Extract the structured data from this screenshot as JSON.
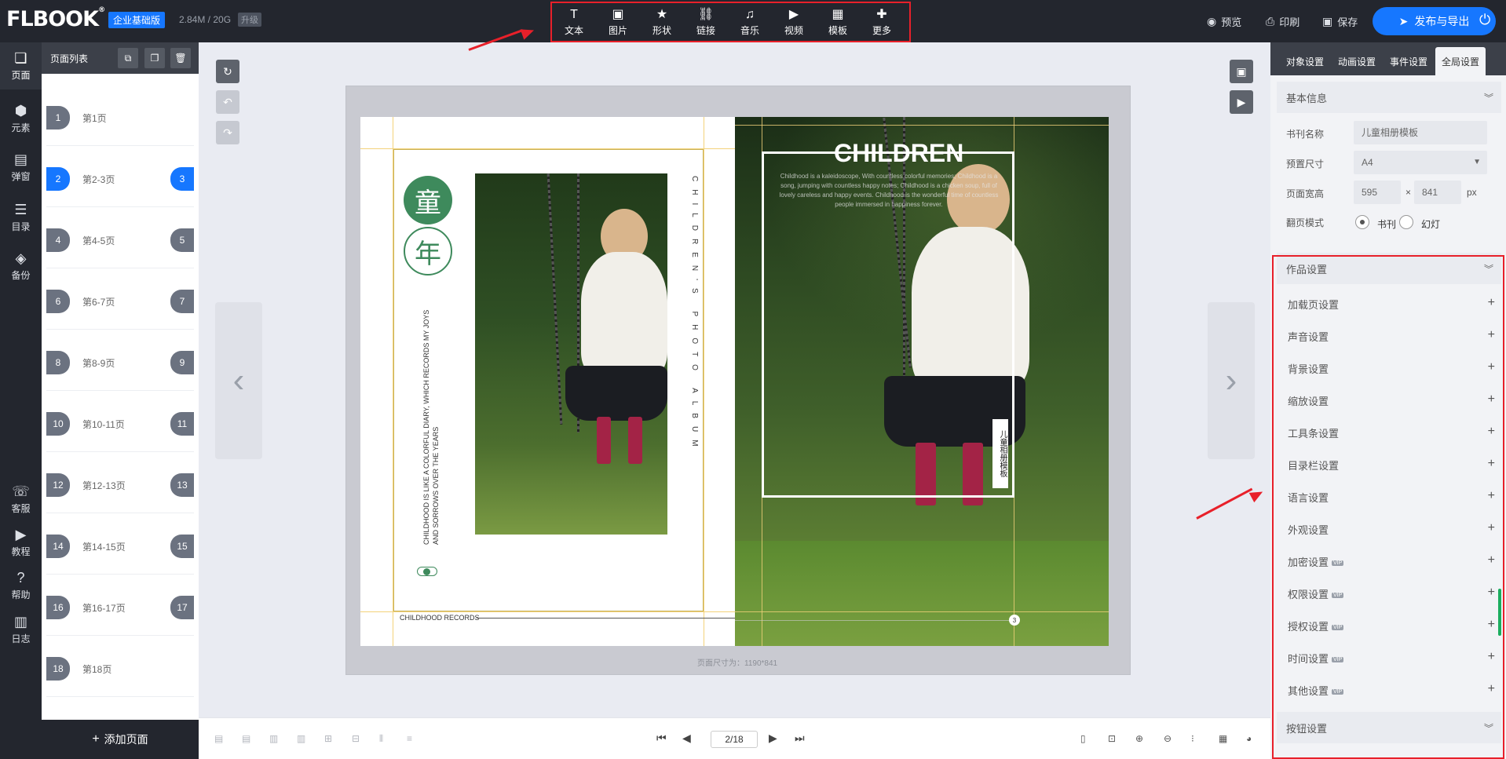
{
  "header": {
    "logo": "FLBOOK",
    "edition": "企业基础版",
    "storage": "2.84M / 20G",
    "upgrade": "升级",
    "tools": [
      {
        "icon": "text-icon",
        "glyph": "T",
        "label": "文本"
      },
      {
        "icon": "image-icon",
        "glyph": "▣",
        "label": "图片"
      },
      {
        "icon": "star-icon",
        "glyph": "★",
        "label": "形状"
      },
      {
        "icon": "link-icon",
        "glyph": "⛓",
        "label": "链接"
      },
      {
        "icon": "music-icon",
        "glyph": "♫",
        "label": "音乐"
      },
      {
        "icon": "play-circle-icon",
        "glyph": "▶",
        "label": "视频"
      },
      {
        "icon": "template-icon",
        "glyph": "▦",
        "label": "模板"
      },
      {
        "icon": "more-icon",
        "glyph": "✚",
        "label": "更多"
      }
    ],
    "preview": "预览",
    "print": "印刷",
    "save": "保存",
    "publish": "发布与导出"
  },
  "leftnav": [
    {
      "icon": "page-icon",
      "glyph": "❏",
      "label": "页面"
    },
    {
      "icon": "elements-icon",
      "glyph": "⬢",
      "label": "元素"
    },
    {
      "icon": "popup-icon",
      "glyph": "▤",
      "label": "弹窗"
    },
    {
      "icon": "toc-icon",
      "glyph": "☰",
      "label": "目录"
    },
    {
      "icon": "backup-icon",
      "glyph": "◈",
      "label": "备份"
    },
    {
      "icon": "support-icon",
      "glyph": "☏",
      "label": "客服"
    },
    {
      "icon": "tutorial-icon",
      "glyph": "▶",
      "label": "教程"
    },
    {
      "icon": "help-icon",
      "glyph": "?",
      "label": "帮助"
    },
    {
      "icon": "log-icon",
      "glyph": "▥",
      "label": "日志"
    }
  ],
  "pagelist": {
    "title": "页面列表",
    "items": [
      {
        "left": "1",
        "label": "第1页",
        "right": ""
      },
      {
        "left": "2",
        "label": "第2-3页",
        "right": "3"
      },
      {
        "left": "4",
        "label": "第4-5页",
        "right": "5"
      },
      {
        "left": "6",
        "label": "第6-7页",
        "right": "7"
      },
      {
        "left": "8",
        "label": "第8-9页",
        "right": "9"
      },
      {
        "left": "10",
        "label": "第10-11页",
        "right": "11"
      },
      {
        "left": "12",
        "label": "第12-13页",
        "right": "13"
      },
      {
        "left": "14",
        "label": "第14-15页",
        "right": "15"
      },
      {
        "left": "16",
        "label": "第16-17页",
        "right": "17"
      },
      {
        "left": "18",
        "label": "第18页",
        "right": ""
      }
    ],
    "add": "添加页面"
  },
  "canvas": {
    "left_title_1": "童",
    "left_title_2": "年",
    "left_vertical": "CHILDHOOD IS LIKE A COLORFUL DIARY, WHICH RECORDS MY JOYS AND SORROWS OVER THE YEARS",
    "album_vertical": "CHILDREN'S PHOTO ALBUM",
    "footer_left": "CHILDHOOD RECORDS",
    "page_number": "3",
    "right_title": "CHILDREN",
    "right_para": "Childhood is a kaleidoscope, With countless colorful memories; Childhood is a song, jumping with countless happy notes; Childhood is a chicken soup, full of lovely careless and happy events. Childhood is the wonderful time of countless people immersed in happiness forever.",
    "right_vertical": "儿童相册模板",
    "page_size": "页面尺寸为：1190*841"
  },
  "bottombar": {
    "page_indicator": "2/18"
  },
  "rightpanel": {
    "tabs": [
      "对象设置",
      "动画设置",
      "事件设置",
      "全局设置"
    ],
    "basic_info": "基本信息",
    "book_name_label": "书刊名称",
    "book_name": "儿童相册模板",
    "preset_label": "预置尺寸",
    "preset": "A4",
    "size_label": "页面宽高",
    "width": "595",
    "height": "841",
    "unit": "px",
    "flip_label": "翻页模式",
    "flip_book": "书刊",
    "flip_slide": "幻灯",
    "work_settings": "作品设置",
    "settings": [
      {
        "label": "加载页设置",
        "vip": false
      },
      {
        "label": "声音设置",
        "vip": false
      },
      {
        "label": "背景设置",
        "vip": false
      },
      {
        "label": "缩放设置",
        "vip": false
      },
      {
        "label": "工具条设置",
        "vip": false
      },
      {
        "label": "目录栏设置",
        "vip": false
      },
      {
        "label": "语言设置",
        "vip": false
      },
      {
        "label": "外观设置",
        "vip": false
      },
      {
        "label": "加密设置",
        "vip": true
      },
      {
        "label": "权限设置",
        "vip": true
      },
      {
        "label": "授权设置",
        "vip": true
      },
      {
        "label": "时间设置",
        "vip": true
      },
      {
        "label": "其他设置",
        "vip": true
      }
    ],
    "vip_badge": "VIP",
    "button_settings": "按钮设置"
  }
}
